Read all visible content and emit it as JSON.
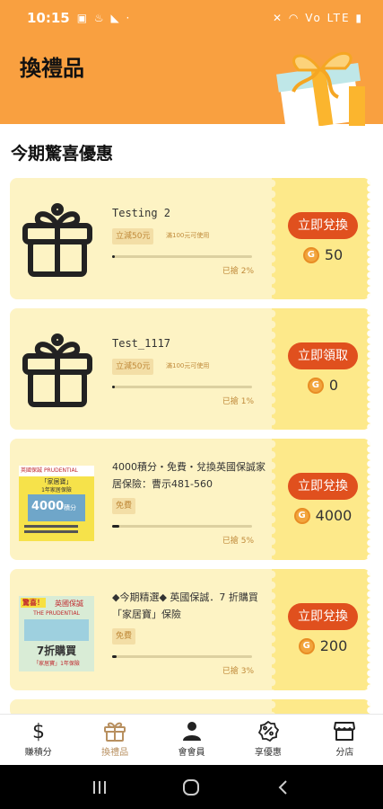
{
  "status_bar": {
    "time": "10:15",
    "left_icons": "▣ ♨ ◣ ·",
    "right_icons": "✕ ◠ Vo LTE ▮"
  },
  "header": {
    "title": "換禮品"
  },
  "section_title": "今期驚喜優惠",
  "coupons": [
    {
      "title": "Testing 2",
      "tag": "立減50元",
      "tag_note": "滿100元可使用",
      "progress": 0.02,
      "grabbed": "已搶 2%",
      "button": "立即兌換",
      "points": "50"
    },
    {
      "title": "Test_1117",
      "tag": "立減50元",
      "tag_note": "滿100元可使用",
      "progress": 0.01,
      "grabbed": "已搶 1%",
      "button": "立即領取",
      "points": "0"
    },
    {
      "title": "4000積分・免費・兌換英國保誠家居保險：曹示481-560",
      "tag": "免費",
      "tag_note": "",
      "progress": 0.05,
      "grabbed": "已搶 5%",
      "button": "立即兌換",
      "points": "4000",
      "thumb_text": {
        "line1": "英國保誠",
        "line2": "PRUDENTIAL",
        "line3": "「家居寶」",
        "line4": "1年家居保險",
        "line5": "4000",
        "line6": "積分"
      }
    },
    {
      "title": "◆今期精選◆ 英國保誠．7 折購買「家居寶」保險",
      "tag": "免費",
      "tag_note": "",
      "progress": 0.03,
      "grabbed": "已搶 3%",
      "button": "立即兌換",
      "points": "200",
      "thumb_text": {
        "line1": "驚喜！",
        "line2": "英國保誠",
        "line3": "THE PRUDENTIAL",
        "line4": "7折購買",
        "line5": "「家居寶」1年保險"
      }
    }
  ],
  "bottom_nav": [
    {
      "label": "賺積分",
      "icon": "dollar-icon"
    },
    {
      "label": "換禮品",
      "icon": "gift-icon",
      "active": true
    },
    {
      "label": "會會員",
      "icon": "person-icon"
    },
    {
      "label": "享優惠",
      "icon": "discount-badge-icon"
    },
    {
      "label": "分店",
      "icon": "store-icon"
    }
  ],
  "colors": {
    "header": "#f9a040",
    "coupon_bg": "#fdf3c4",
    "coupon_right": "#fde98a",
    "button": "#e0501e",
    "coin": "#f2a43c"
  }
}
